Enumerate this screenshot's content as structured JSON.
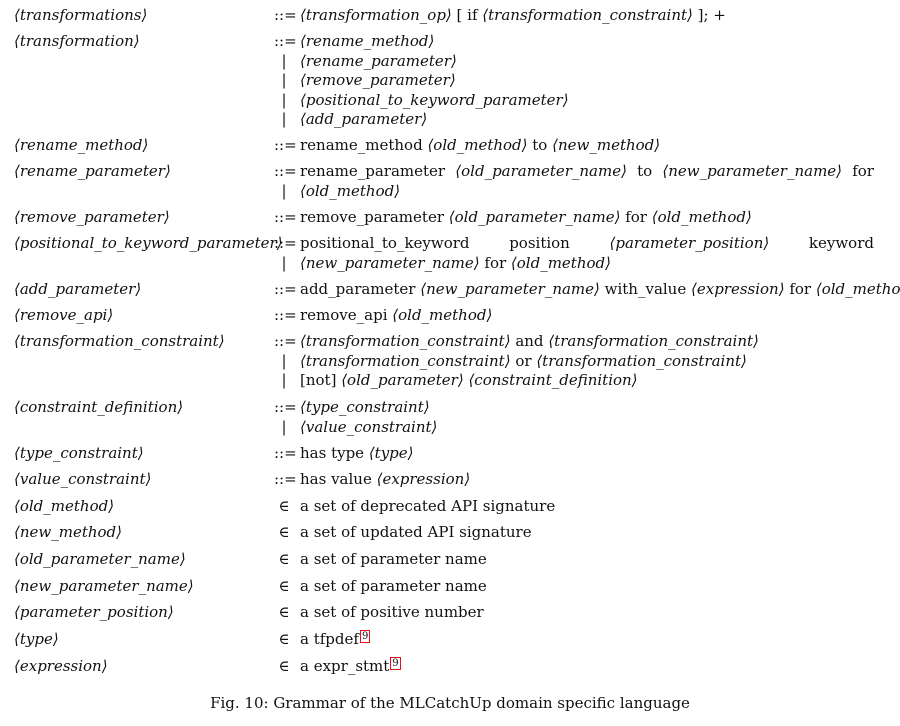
{
  "grammar": {
    "rules": [
      {
        "lhs": "⟨transformations⟩",
        "op": "::=",
        "lines": [
          [
            {
              "t": "⟨transformation_op⟩",
              "nt": true
            },
            {
              "t": " [ if "
            },
            {
              "t": "⟨transformation_constraint⟩",
              "nt": true
            },
            {
              "t": " ]; +"
            }
          ]
        ]
      },
      {
        "lhs": "⟨transformation⟩",
        "op": "::=",
        "lines": [
          [
            {
              "t": "⟨rename_method⟩",
              "nt": true
            }
          ],
          [
            {
              "t": "⟨rename_parameter⟩",
              "nt": true
            }
          ],
          [
            {
              "t": "⟨remove_parameter⟩",
              "nt": true
            }
          ],
          [
            {
              "t": "⟨positional_to_keyword_parameter⟩",
              "nt": true
            }
          ],
          [
            {
              "t": "⟨add_parameter⟩",
              "nt": true
            }
          ]
        ]
      },
      {
        "lhs": "⟨rename_method⟩",
        "op": "::=",
        "lines": [
          [
            {
              "t": "rename_method "
            },
            {
              "t": "⟨old_method⟩",
              "nt": true
            },
            {
              "t": " to "
            },
            {
              "t": "⟨new_method⟩",
              "nt": true
            }
          ]
        ]
      },
      {
        "lhs": "⟨rename_parameter⟩",
        "op": "::=",
        "lines": [
          [
            {
              "t": "rename_parameter"
            },
            {
              "t": "⟨old_parameter_name⟩",
              "nt": true
            },
            {
              "t": "to"
            },
            {
              "t": "⟨new_parameter_name⟩",
              "nt": true
            },
            {
              "t": "for"
            }
          ],
          [
            {
              "t": "⟨old_method⟩",
              "nt": true
            }
          ]
        ],
        "justify_first": true
      },
      {
        "lhs": "⟨remove_parameter⟩",
        "op": "::=",
        "lines": [
          [
            {
              "t": "remove_parameter "
            },
            {
              "t": "⟨old_parameter_name⟩",
              "nt": true
            },
            {
              "t": " for "
            },
            {
              "t": "⟨old_method⟩",
              "nt": true
            }
          ]
        ]
      },
      {
        "lhs": "⟨positional_to_keyword_parameter⟩",
        "op": "::=",
        "lines": [
          [
            {
              "t": "positional_to_keyword"
            },
            {
              "t": "position"
            },
            {
              "t": "⟨parameter_position⟩",
              "nt": true
            },
            {
              "t": "keyword"
            }
          ],
          [
            {
              "t": "⟨new_parameter_name⟩",
              "nt": true
            },
            {
              "t": " for "
            },
            {
              "t": "⟨old_method⟩",
              "nt": true
            }
          ]
        ],
        "justify_first": true
      },
      {
        "lhs": "⟨add_parameter⟩",
        "op": "::=",
        "lines": [
          [
            {
              "t": "add_parameter "
            },
            {
              "t": "⟨new_parameter_name⟩",
              "nt": true
            },
            {
              "t": " with_value "
            },
            {
              "t": "⟨expression⟩",
              "nt": true
            },
            {
              "t": " for "
            },
            {
              "t": "⟨old_method⟩",
              "nt": true
            }
          ]
        ]
      },
      {
        "lhs": "⟨remove_api⟩",
        "op": "::=",
        "lines": [
          [
            {
              "t": "remove_api "
            },
            {
              "t": "⟨old_method⟩",
              "nt": true
            }
          ]
        ]
      },
      {
        "lhs": "⟨transformation_constraint⟩",
        "op": "::=",
        "lines": [
          [
            {
              "t": "⟨transformation_constraint⟩",
              "nt": true
            },
            {
              "t": " and "
            },
            {
              "t": "⟨transformation_constraint⟩",
              "nt": true
            }
          ],
          [
            {
              "t": "⟨transformation_constraint⟩",
              "nt": true
            },
            {
              "t": " or "
            },
            {
              "t": "⟨transformation_constraint⟩",
              "nt": true
            }
          ],
          [
            {
              "t": "[not] "
            },
            {
              "t": "⟨old_parameter⟩",
              "nt": true
            },
            {
              "t": " "
            },
            {
              "t": "⟨constraint_definition⟩",
              "nt": true
            }
          ]
        ]
      },
      {
        "lhs": "⟨constraint_definition⟩",
        "op": "::=",
        "lines": [
          [
            {
              "t": "⟨type_constraint⟩",
              "nt": true
            }
          ],
          [
            {
              "t": "⟨value_constraint⟩",
              "nt": true
            }
          ]
        ]
      },
      {
        "lhs": "⟨type_constraint⟩",
        "op": "::=",
        "lines": [
          [
            {
              "t": "has type "
            },
            {
              "t": "⟨type⟩",
              "nt": true
            }
          ]
        ]
      },
      {
        "lhs": "⟨value_constraint⟩",
        "op": "::=",
        "lines": [
          [
            {
              "t": "has value "
            },
            {
              "t": "⟨expression⟩",
              "nt": true
            }
          ]
        ]
      },
      {
        "lhs": "⟨old_method⟩",
        "op": "∈",
        "lines": [
          [
            {
              "t": "a set of deprecated API signature"
            }
          ]
        ]
      },
      {
        "lhs": "⟨new_method⟩",
        "op": "∈",
        "lines": [
          [
            {
              "t": "a set of updated API signature"
            }
          ]
        ]
      },
      {
        "lhs": "⟨old_parameter_name⟩",
        "op": "∈",
        "lines": [
          [
            {
              "t": "a set of parameter name"
            }
          ]
        ]
      },
      {
        "lhs": "⟨new_parameter_name⟩",
        "op": "∈",
        "lines": [
          [
            {
              "t": "a set of parameter name"
            }
          ]
        ]
      },
      {
        "lhs": "⟨parameter_position⟩",
        "op": "∈",
        "lines": [
          [
            {
              "t": "a set of positive number"
            }
          ]
        ]
      },
      {
        "lhs": "⟨type⟩",
        "op": "∈",
        "lines": [
          [
            {
              "t": "a tfpdef"
            },
            {
              "t": "9",
              "ref": true
            }
          ]
        ]
      },
      {
        "lhs": "⟨expression⟩",
        "op": "∈",
        "lines": [
          [
            {
              "t": "a expr_stmt"
            },
            {
              "t": "9",
              "ref": true
            }
          ]
        ]
      }
    ],
    "alt_symbol": "|"
  },
  "caption": "Fig. 10: Grammar of the MLCatchUp domain specific language",
  "colors": {
    "text": "#111111",
    "link_box": "#e8101a",
    "background": "#ffffff"
  }
}
